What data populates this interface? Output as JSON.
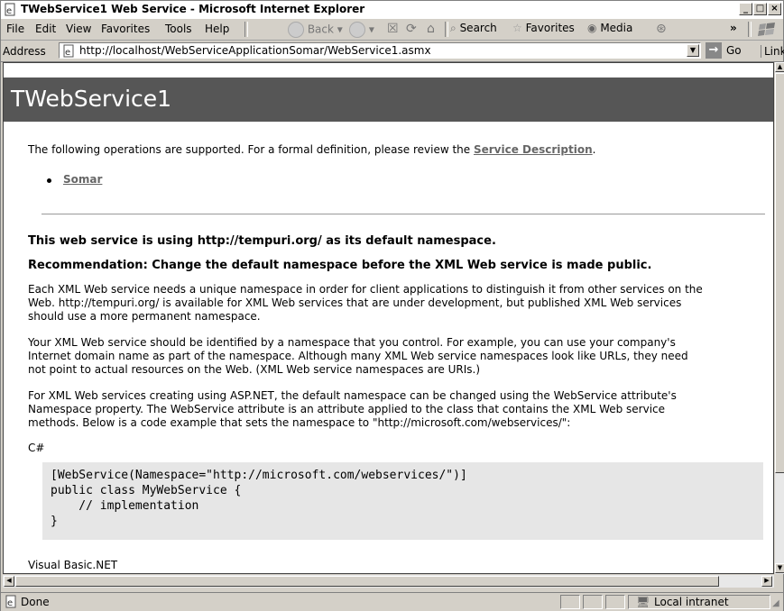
{
  "window": {
    "title": "TWebService1 Web Service - Microsoft Internet Explorer",
    "minimize": "_",
    "maximize": "□",
    "close": "×"
  },
  "menu": [
    "File",
    "Edit",
    "View",
    "Favorites",
    "Tools",
    "Help"
  ],
  "toolbar": {
    "back": "Back",
    "search": "Search",
    "favorites": "Favorites",
    "media": "Media",
    "chevron": "»"
  },
  "address": {
    "label": "Address",
    "url": "http://localhost/WebServiceApplicationSomar/WebService1.asmx",
    "go": "Go",
    "links": "Links"
  },
  "page": {
    "title": "TWebService1",
    "intro_prefix": "The following operations are supported. For a formal definition, please review the ",
    "service_description": "Service Description",
    "intro_suffix": ".",
    "operations": [
      "Somar"
    ],
    "namespace_heading": "This web service is using http://tempuri.org/ as its default namespace.",
    "recommendation_heading": "Recommendation: Change the default namespace before the XML Web service is made public.",
    "para1": [
      "Each XML Web service needs a unique namespace in order for client applications to distinguish it from other services on the",
      "Web. http://tempuri.org/ is available for XML Web services that are under development, but published XML Web services",
      "should use a more permanent namespace."
    ],
    "para2": [
      "Your XML Web service should be identified by a namespace that you control. For example, you can use your company's",
      "Internet domain name as part of the namespace. Although many XML Web service namespaces look like URLs, they need",
      "not point to actual resources on the Web. (XML Web service namespaces are URIs.)"
    ],
    "para3": [
      "For XML Web services creating using ASP.NET, the default namespace can be changed using the WebService attribute's",
      "Namespace property. The WebService attribute is an attribute applied to the class that contains the XML Web service",
      "methods. Below is a code example that sets the namespace to \"http://microsoft.com/webservices/\":"
    ],
    "csharp_label": "C#",
    "code": [
      "[WebService(Namespace=\"http://microsoft.com/webservices/\")]",
      "public class MyWebService {",
      "    // implementation",
      "}"
    ],
    "vb_label": "Visual Basic.NET"
  },
  "status": {
    "text": "Done",
    "zone": "Local intranet"
  }
}
